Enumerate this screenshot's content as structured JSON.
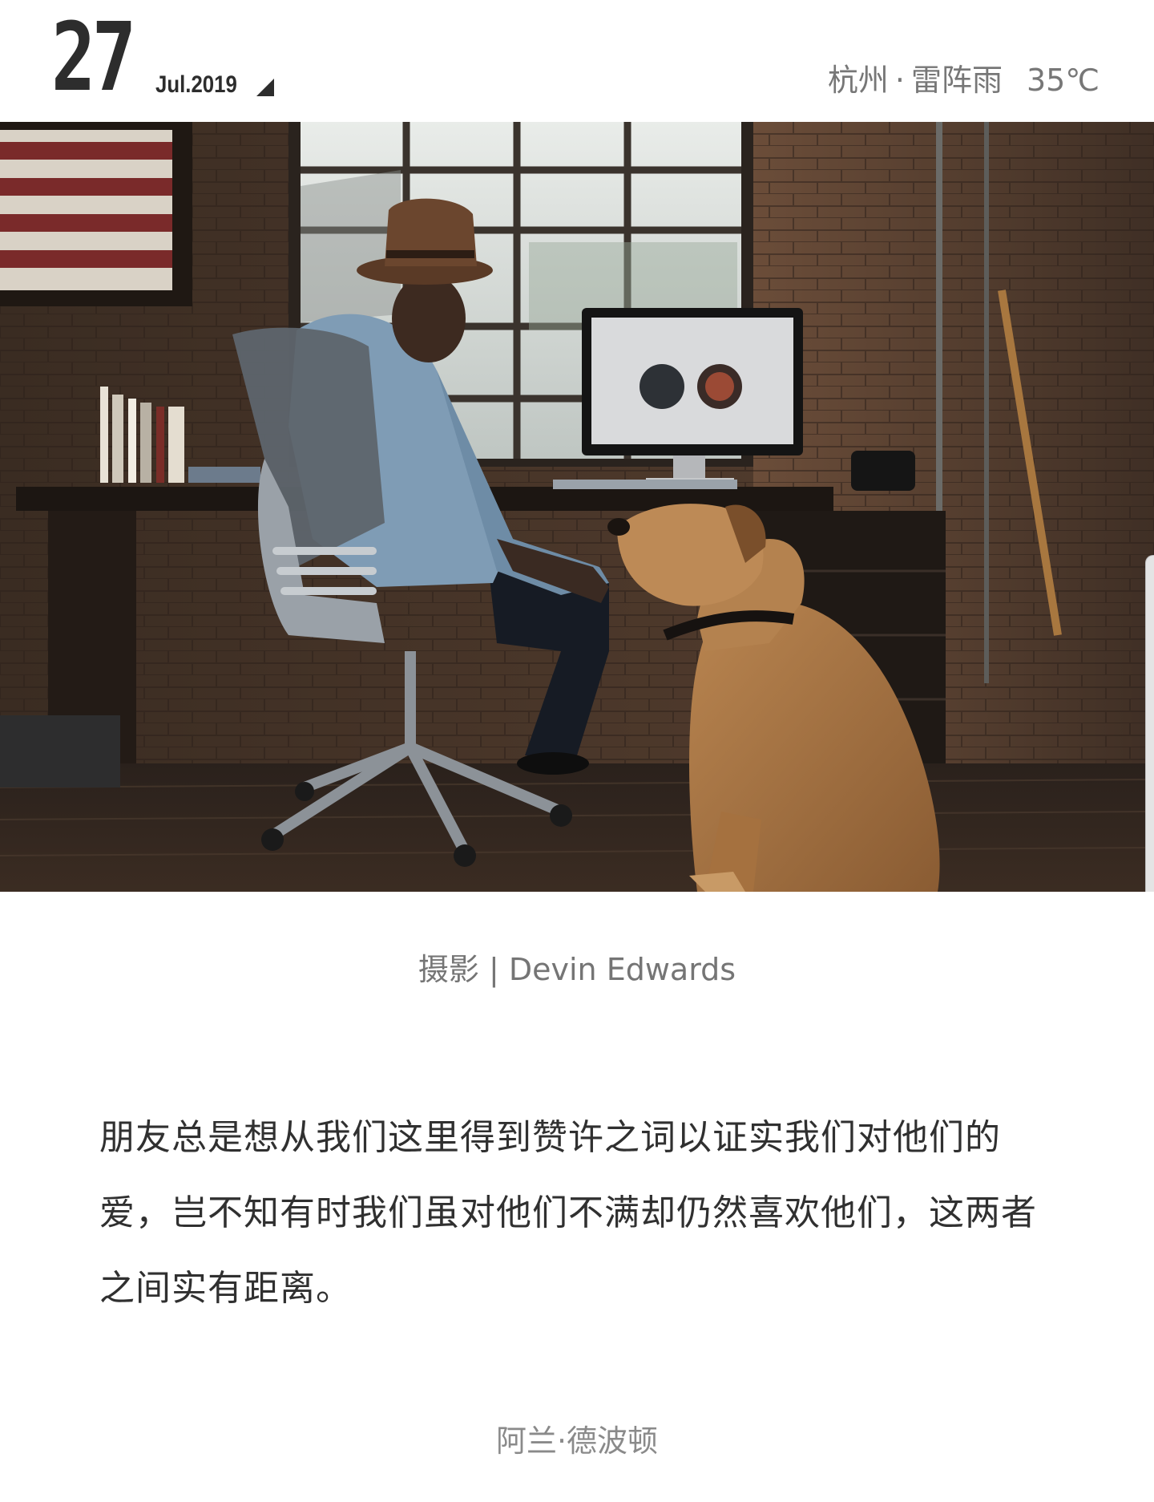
{
  "header": {
    "day": "27",
    "month_year": "Jul.2019",
    "city": "杭州",
    "separator": "·",
    "condition": "雷阵雨",
    "temperature": "35℃"
  },
  "photo": {
    "caption": "摄影 | Devin Edwards"
  },
  "quote": {
    "text": "朋友总是想从我们这里得到赞许之词以证实我们对他们的爱，岂不知有时我们虽对他们不满却仍然喜欢他们，这两者之间实有距离。",
    "author": "阿兰·德波顿"
  },
  "colors": {
    "date_text": "#2d2d2d",
    "weather_text": "#777777",
    "body_text": "#303030",
    "caption_text": "#757575"
  },
  "icons": {
    "date_toggle": "triangle-corner-icon"
  }
}
